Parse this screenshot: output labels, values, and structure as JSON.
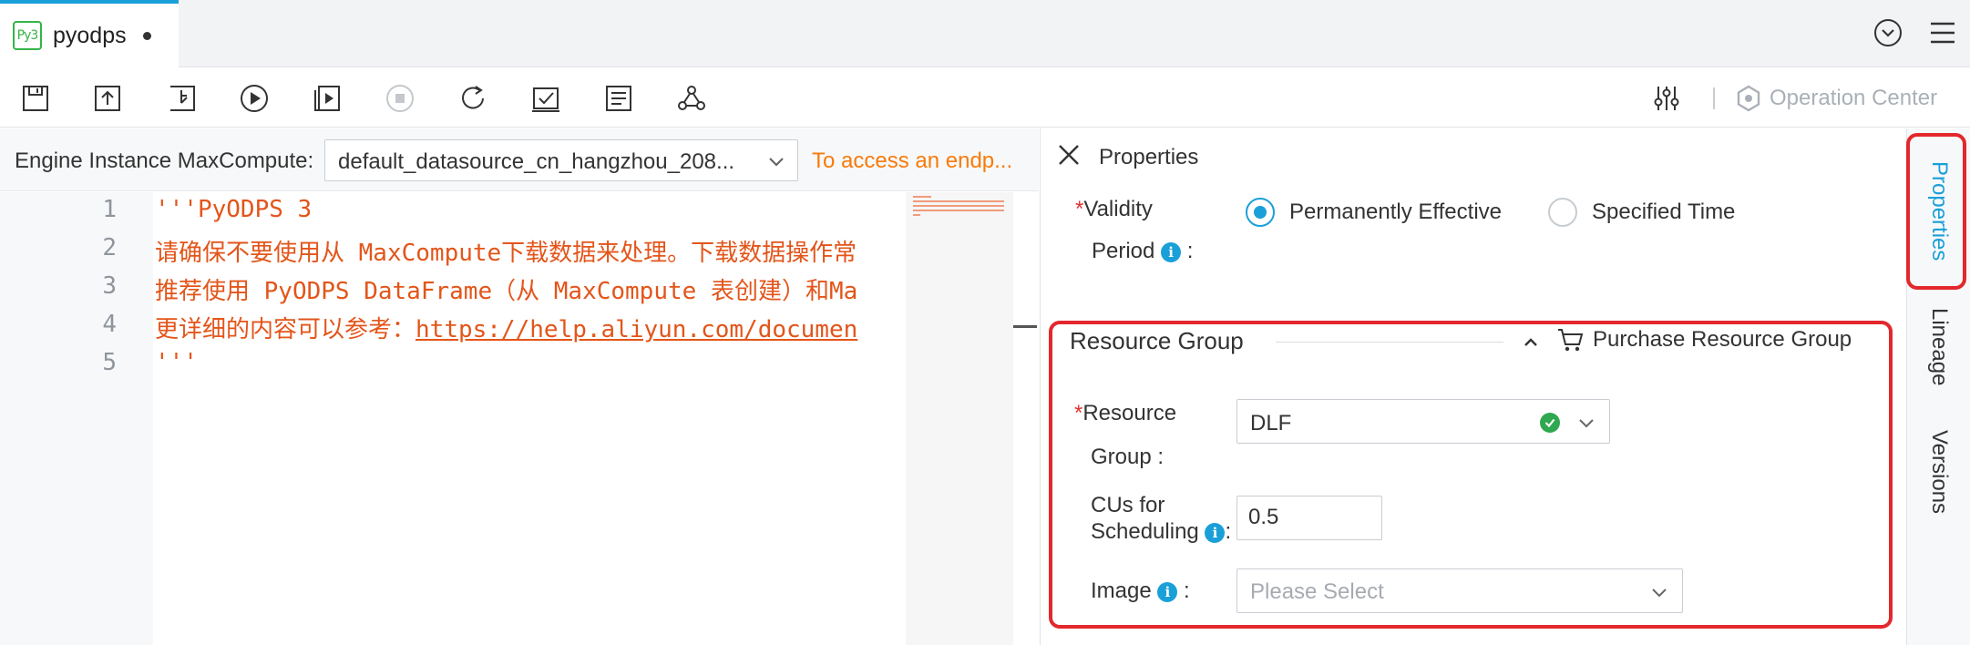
{
  "tab": {
    "badge": "Py3",
    "title": "pyodps",
    "unsaved": true
  },
  "toolbar": {
    "buttons": [
      "save-icon",
      "upload-icon",
      "submit-icon",
      "run-icon",
      "run-with-params-icon",
      "stop-icon",
      "refresh-icon",
      "check-icon",
      "format-icon",
      "dependency-icon"
    ],
    "operation_center": "Operation Center"
  },
  "engine": {
    "label": "Engine Instance MaxCompute:",
    "selected": "default_datasource_cn_hangzhou_208...",
    "warning": "To access an endp..."
  },
  "editor": {
    "line_numbers": [
      "1",
      "2",
      "3",
      "4",
      "5"
    ],
    "lines": [
      "'''PyODPS 3",
      "请确保不要使用从 MaxCompute下载数据来处理。下载数据操作常",
      "推荐使用 PyODPS DataFrame（从 MaxCompute 表创建）和Ma",
      "更详细的内容可以参考：",
      "'''"
    ],
    "link": "https://help.aliyun.com/documen"
  },
  "properties": {
    "title": "Properties",
    "validity": {
      "label_line1": "Validity",
      "label_line2": "Period",
      "colon": ":",
      "options": [
        "Permanently Effective",
        "Specified Time"
      ],
      "selected": "Permanently Effective"
    },
    "resource_group": {
      "section_title": "Resource Group",
      "purchase": "Purchase Resource Group",
      "rg_label_line1": "Resource",
      "rg_label_line2": "Group :",
      "rg_value": "DLF",
      "cu_label_line1": "CUs for",
      "cu_label_line2": "Scheduling",
      "colon": ":",
      "cu_value": "0.5",
      "image_label": "Image",
      "image_colon": ":",
      "image_placeholder": "Please Select"
    }
  },
  "side_tabs": {
    "properties": "Properties",
    "lineage": "Lineage",
    "versions": "Versions",
    "active": "Properties"
  },
  "colors": {
    "accent": "#1aa0d8",
    "highlight": "#e3282d",
    "code": "#e3551a",
    "warning": "#f77b0b"
  }
}
